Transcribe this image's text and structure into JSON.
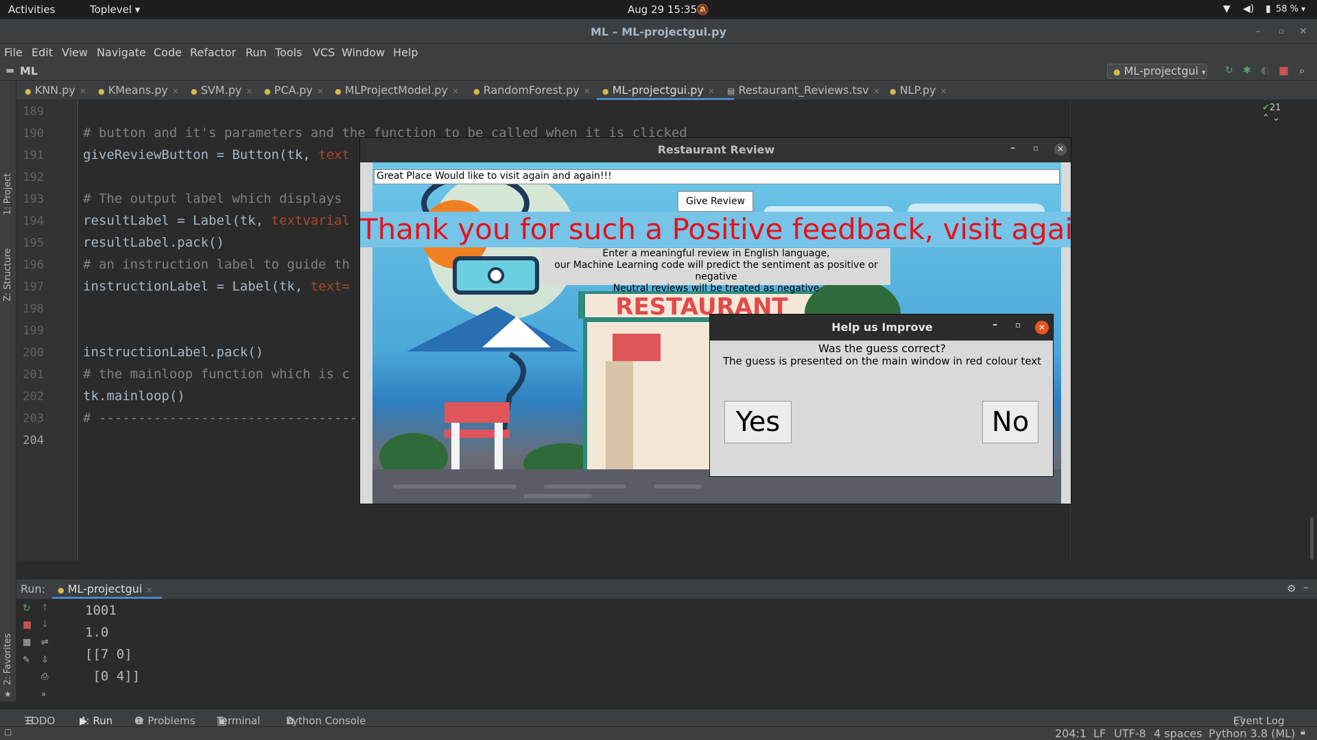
{
  "topbar": {
    "activities": "Activities",
    "app_menu": "Toplevel",
    "datetime": "Aug 29  15:35",
    "battery": "58 %"
  },
  "window": {
    "title": "ML – ML-projectgui.py"
  },
  "menubar": [
    "File",
    "Edit",
    "View",
    "Navigate",
    "Code",
    "Refactor",
    "Run",
    "Tools",
    "VCS",
    "Window",
    "Help"
  ],
  "navbar": {
    "project": "ML",
    "run_config": "ML-projectgui"
  },
  "tabs": [
    {
      "label": "KNN.py"
    },
    {
      "label": "KMeans.py"
    },
    {
      "label": "SVM.py"
    },
    {
      "label": "PCA.py"
    },
    {
      "label": "MLProjectModel.py"
    },
    {
      "label": "RandomForest.py"
    },
    {
      "label": "ML-projectgui.py"
    },
    {
      "label": "Restaurant_Reviews.tsv"
    },
    {
      "label": "NLP.py"
    }
  ],
  "side_tools": {
    "project": "1: Project",
    "structure": "Z: Structure",
    "favorites": "2: Favorites"
  },
  "inspection_count": "21",
  "line_numbers": [
    "189",
    "190",
    "191",
    "192",
    "193",
    "194",
    "195",
    "196",
    "197",
    "198",
    "199",
    "200",
    "201",
    "202",
    "203",
    "204"
  ],
  "code": {
    "l190": "# button and it's parameters and the function to be called when it is clicked",
    "l191a": "giveReviewButton = Button(tk, ",
    "l191b": "text",
    "l193": "# The output label which displays",
    "l194a": "resultLabel = Label(tk, ",
    "l194b": "textvarial",
    "l195": "resultLabel.pack()",
    "l196": "# an instruction label to guide th",
    "l197a": "instructionLabel = Label(tk, ",
    "l197b": "text=",
    "l200": "instructionLabel.pack()",
    "l201": "# the mainloop function which is c",
    "l202": "tk.mainloop()",
    "l203": "# ---------------------------------"
  },
  "run_panel": {
    "label": "Run:",
    "tab": "ML-projectgui",
    "output": [
      "1001",
      "1.0",
      "[[7 0]",
      " [0 4]]"
    ]
  },
  "bottom_tools": [
    "TODO",
    "4: Run",
    "6: Problems",
    "Terminal",
    "Python Console",
    "Event Log"
  ],
  "statusbar": {
    "position": "204:1",
    "line_sep": "LF",
    "encoding": "UTF-8",
    "indent": "4 spaces",
    "interpreter": "Python 3.8 (ML)"
  },
  "restaurant_window": {
    "title": "Restaurant Review",
    "review_text": "Great Place Would like to visit again and again!!!",
    "button": "Give Review",
    "result": "Thank you for such a Positive feedback, visit again!",
    "instruction_1": "Enter a meaningful review in English language,",
    "instruction_2": "our Machine Learning code will predict the sentiment as positive or negative",
    "instruction_3": "Neutral reviews will be treated as negative",
    "sign": "RESTAURANT"
  },
  "help_dialog": {
    "title": "Help us Improve",
    "question": "Was the guess correct?",
    "hint": "The guess is presented on the main window in red colour text",
    "yes": "Yes",
    "no": "No"
  },
  "colors": {
    "result_text": "#e8101a",
    "ide_bg": "#2b2b2b",
    "dialog_bg": "#d9d9d9"
  }
}
